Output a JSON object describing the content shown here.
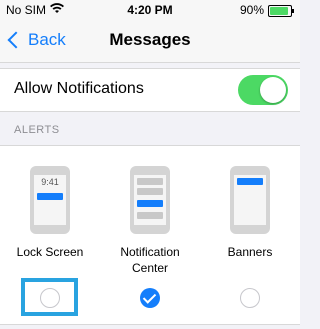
{
  "status_bar": {
    "carrier": "No SIM",
    "time": "4:20 PM",
    "battery_percent": "90%"
  },
  "nav": {
    "back_label": "Back",
    "title": "Messages"
  },
  "allow_notifications": {
    "label": "Allow Notifications",
    "enabled": true
  },
  "alerts": {
    "header": "ALERTS",
    "options": [
      {
        "label": "Lock Screen",
        "checked": false,
        "preview_time": "9:41"
      },
      {
        "label": "Notification Center",
        "label_line1": "Notification",
        "label_line2": "Center",
        "checked": true
      },
      {
        "label": "Banners",
        "checked": false
      }
    ]
  },
  "colors": {
    "accent": "#147efb",
    "toggle_on": "#4cd964",
    "highlight": "#29a3e0"
  }
}
